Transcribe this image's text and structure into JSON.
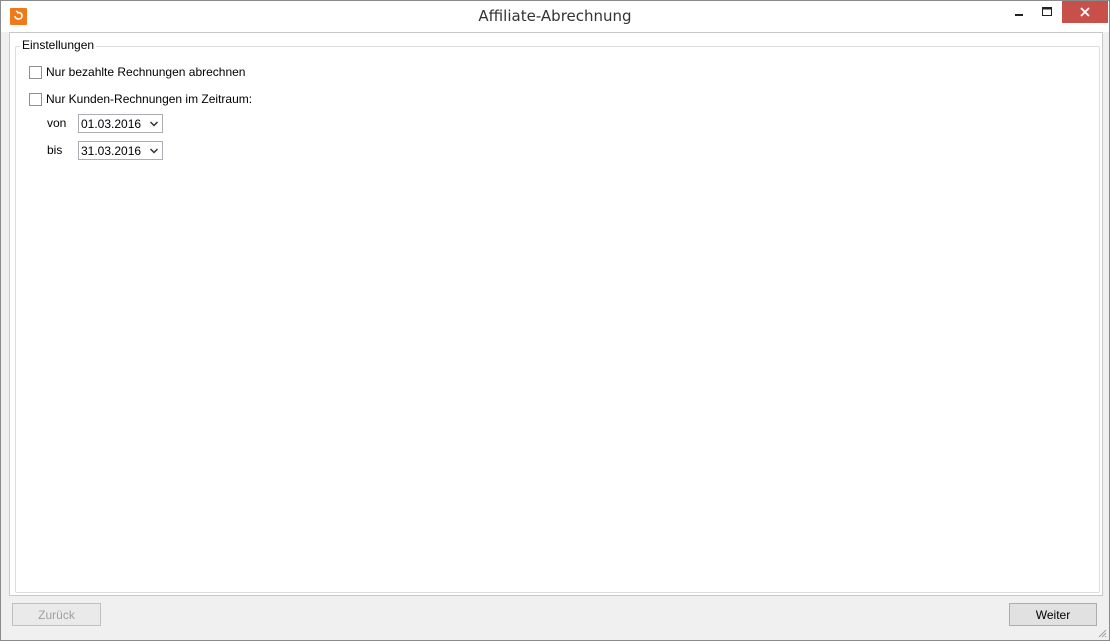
{
  "window": {
    "title": "Affiliate-Abrechnung",
    "icon": "app-logo-icon"
  },
  "controls": {
    "minimize_icon": "minimize-icon",
    "maximize_icon": "maximize-icon",
    "close_icon": "close-icon",
    "close_color": "#c7504a"
  },
  "settings": {
    "group_label": "Einstellungen",
    "paid_only": {
      "label": "Nur bezahlte Rechnungen abrechnen",
      "checked": false
    },
    "period_only": {
      "label": "Nur Kunden-Rechnungen im Zeitraum:",
      "checked": false
    },
    "from": {
      "label": "von",
      "value": "01.03.2016"
    },
    "to": {
      "label": "bis",
      "value": "31.03.2016"
    }
  },
  "footer": {
    "back_label": "Zurück",
    "back_enabled": false,
    "next_label": "Weiter",
    "next_enabled": true
  },
  "colors": {
    "accent": "#f07a1a"
  }
}
